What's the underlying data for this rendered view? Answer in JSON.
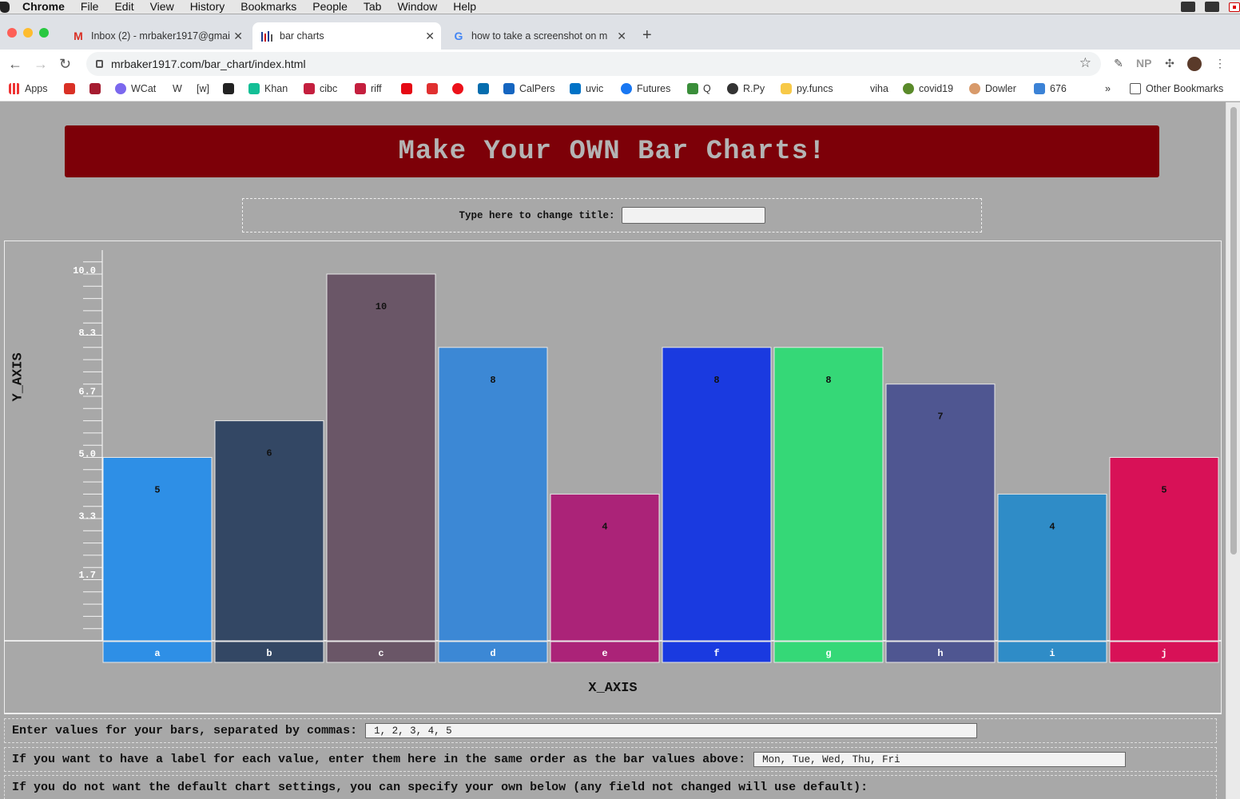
{
  "menubar": {
    "app": "Chrome",
    "items": [
      "File",
      "Edit",
      "View",
      "History",
      "Bookmarks",
      "People",
      "Tab",
      "Window",
      "Help"
    ]
  },
  "tabs": [
    {
      "title": "Inbox (2) - mrbaker1917@gmai",
      "icon": "gmail-icon",
      "active": false
    },
    {
      "title": "bar charts",
      "icon": "bar-chart-icon",
      "active": true
    },
    {
      "title": "how to take a screenshot on m",
      "icon": "google-icon",
      "active": false
    }
  ],
  "toolbar": {
    "url": "mrbaker1917.com/bar_chart/index.html"
  },
  "bookmarks": {
    "items": [
      "Apps",
      "",
      "",
      "WCat",
      "W",
      "[w]",
      "",
      "Khan",
      "cibc",
      "riff",
      "",
      "",
      "",
      "",
      "CalPers",
      "uvic",
      "Futures",
      "Q",
      "R.Py",
      "py.funcs",
      "viha",
      "covid19",
      "Dowler",
      "676"
    ],
    "more": "»",
    "other": "Other Bookmarks"
  },
  "page": {
    "banner_title": "Make Your OWN Bar Charts!",
    "title_label": "Type here to change title:",
    "title_value": "",
    "values_label": "Enter values for your bars, separated by commas:",
    "values_input": "1, 2, 3, 4, 5",
    "labels_label": "If you want to have a label for each value, enter them here in the same order as the bar values above:",
    "labels_input": "Mon, Tue, Wed, Thu, Fri",
    "defaults_label": "If you do not want the default chart settings, you can specify your own below (any field not changed will use default):"
  },
  "chart_data": {
    "type": "bar",
    "categories": [
      "a",
      "b",
      "c",
      "d",
      "e",
      "f",
      "g",
      "h",
      "i",
      "j"
    ],
    "values": [
      5,
      6,
      10,
      8,
      4,
      8,
      8,
      7,
      4,
      5
    ],
    "colors": [
      "#2e8fe6",
      "#334764",
      "#6a5667",
      "#3c88d5",
      "#ab2378",
      "#1a3ae0",
      "#35d877",
      "#4f5691",
      "#2f8cc7",
      "#d81157"
    ],
    "xlabel": "X_AXIS",
    "ylabel": "Y_AXIS",
    "yticks": [
      "1.7",
      "3.3",
      "5.0",
      "6.7",
      "8.3",
      "10.0"
    ],
    "ylim": [
      0,
      10
    ]
  }
}
